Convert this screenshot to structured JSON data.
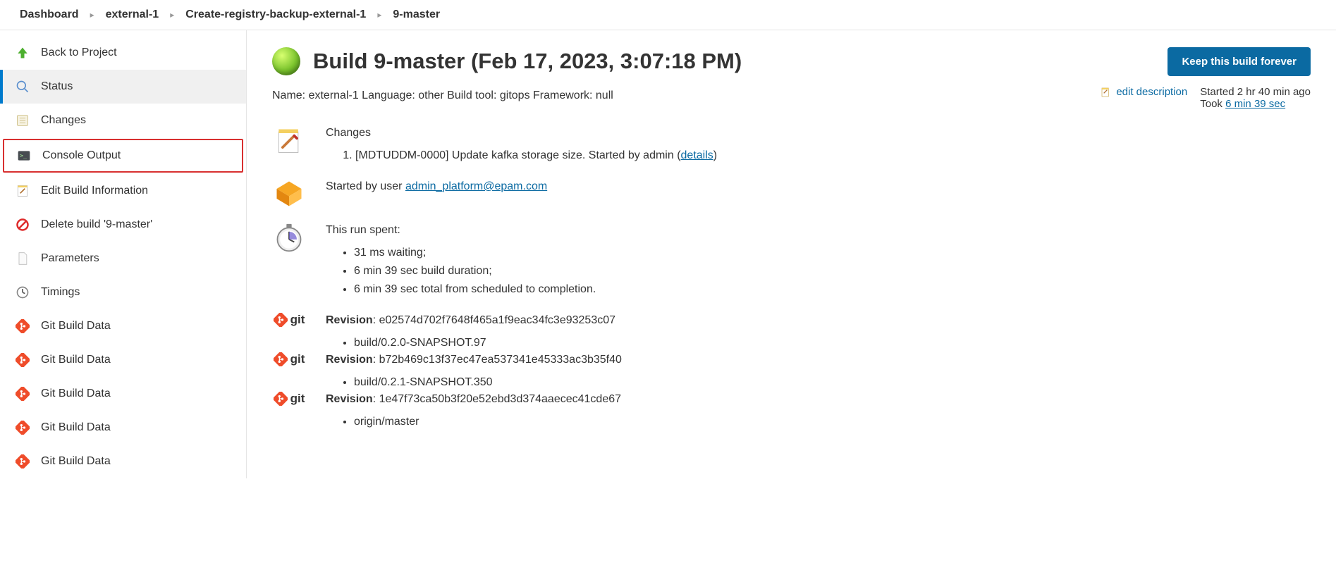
{
  "breadcrumbs": [
    "Dashboard",
    "external-1",
    "Create-registry-backup-external-1",
    "9-master"
  ],
  "sidebar": {
    "back": "Back to Project",
    "status": "Status",
    "changes": "Changes",
    "console": "Console Output",
    "edit_info": "Edit Build Information",
    "delete": "Delete build '9-master'",
    "parameters": "Parameters",
    "timings": "Timings",
    "git_data": "Git Build Data"
  },
  "header": {
    "title": "Build 9-master (Feb 17, 2023, 3:07:18 PM)",
    "description": "Name: external-1 Language: other Build tool: gitops Framework: null",
    "keep_label": "Keep this build forever",
    "edit_desc": "edit description",
    "started": "Started 2 hr 40 min ago",
    "took_prefix": "Took ",
    "took_value": "6 min 39 sec"
  },
  "changes": {
    "heading": "Changes",
    "item_prefix": "[MDTUDDM-0000] Update kafka storage size. Started by admin (",
    "details": "details",
    "item_suffix": ")"
  },
  "started_by": {
    "prefix": "Started by user ",
    "user": "admin_platform@epam.com"
  },
  "run_spent": {
    "heading": "This run spent:",
    "items": [
      "31 ms waiting;",
      "6 min 39 sec build duration;",
      "6 min 39 sec total from scheduled to completion."
    ]
  },
  "revisions": [
    {
      "hash": "e02574d702f7648f465a1f9eac34fc3e93253c07",
      "ref": "build/0.2.0-SNAPSHOT.97"
    },
    {
      "hash": "b72b469c13f37ec47ea537341e45333ac3b35f40",
      "ref": "build/0.2.1-SNAPSHOT.350"
    },
    {
      "hash": "1e47f73ca50b3f20e52ebd3d374aaecec41cde67",
      "ref": "origin/master"
    }
  ],
  "labels": {
    "revision": "Revision"
  }
}
